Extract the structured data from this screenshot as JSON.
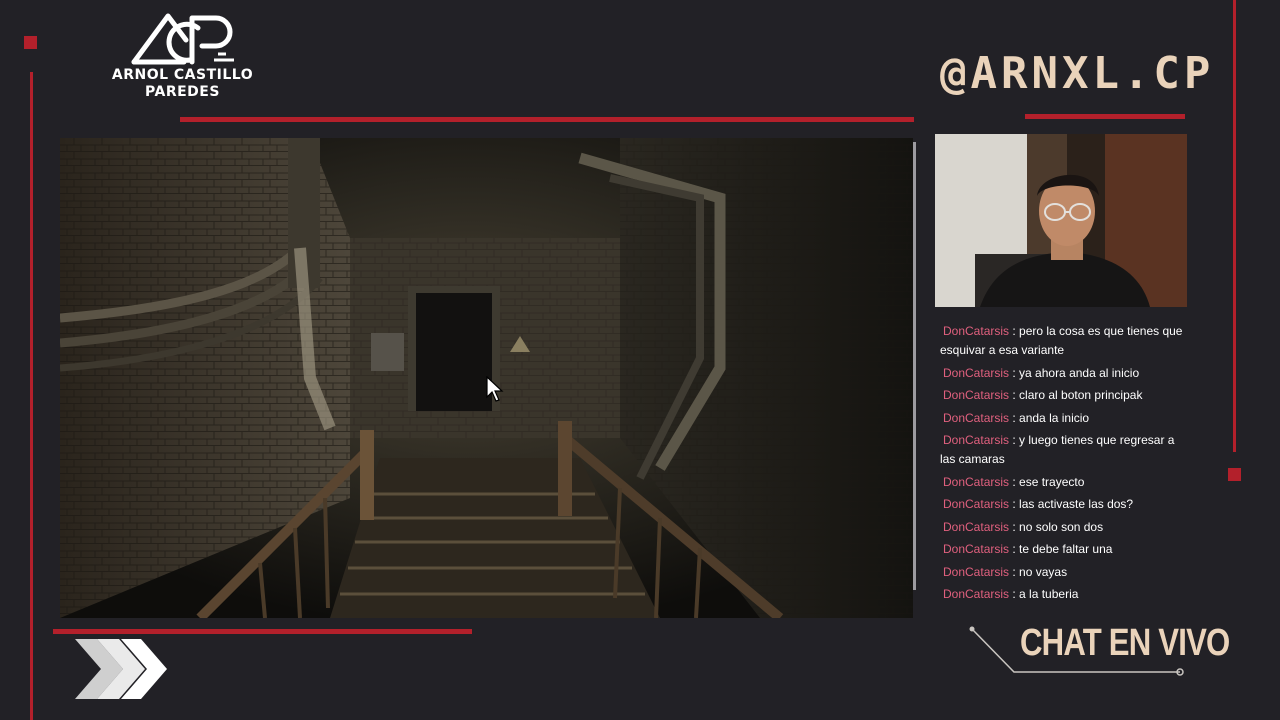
{
  "brand": {
    "name_line1": "ARNOL CASTILLO",
    "name_line2": "PAREDES",
    "logo_icon": "acp-logo-icon"
  },
  "social": {
    "handle": "@ARNXL.CP"
  },
  "game": {
    "scene": "dark-basement-stairway-scene",
    "cursor_icon": "mouse-pointer-icon"
  },
  "webcam": {
    "label": "streamer-webcam"
  },
  "chat": {
    "label": "CHAT EN VIVO",
    "messages": [
      {
        "user": "DonCatarsis",
        "text": " : pero la cosa es que tienes que esquivar a esa variante"
      },
      {
        "user": "DonCatarsis",
        "text": " : ya ahora anda al inicio"
      },
      {
        "user": "DonCatarsis",
        "text": " : claro al boton principak"
      },
      {
        "user": "DonCatarsis",
        "text": " : anda la inicio"
      },
      {
        "user": "DonCatarsis",
        "text": " : y luego tienes que regresar a las camaras"
      },
      {
        "user": "DonCatarsis",
        "text": " : ese trayecto"
      },
      {
        "user": "DonCatarsis",
        "text": " : las activaste las dos?"
      },
      {
        "user": "DonCatarsis",
        "text": " : no solo son dos"
      },
      {
        "user": "DonCatarsis",
        "text": " : te debe faltar una"
      },
      {
        "user": "DonCatarsis",
        "text": " : no vayas"
      },
      {
        "user": "DonCatarsis",
        "text": " : a la tuberia"
      }
    ]
  },
  "colors": {
    "background": "#222126",
    "accent_red": "#b3202b",
    "cream": "#ead3ba",
    "chat_username": "#e0607e"
  }
}
